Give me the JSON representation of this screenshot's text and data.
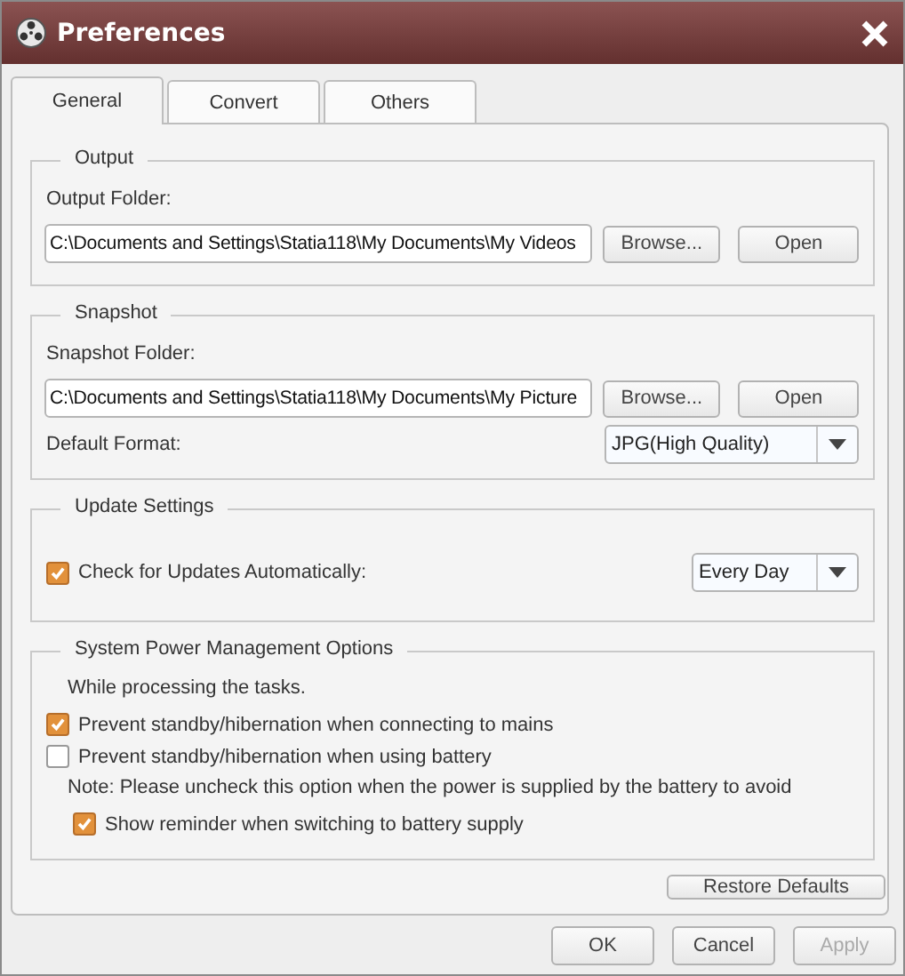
{
  "window": {
    "title": "Preferences"
  },
  "tabs": [
    {
      "label": "General",
      "selected": true
    },
    {
      "label": "Convert",
      "selected": false
    },
    {
      "label": "Others",
      "selected": false
    }
  ],
  "groups": [
    {
      "title": "Output",
      "rows": [
        {
          "kind": "label",
          "text": "Output Folder:"
        },
        {
          "kind": "path",
          "value": "C:\\Documents and Settings\\Statia118\\My Documents\\My Videos",
          "buttons": [
            "Browse...",
            "Open"
          ]
        }
      ]
    },
    {
      "title": "Snapshot",
      "rows": [
        {
          "kind": "label",
          "text": "Snapshot Folder:"
        },
        {
          "kind": "path",
          "value": "C:\\Documents and Settings\\Statia118\\My Documents\\My Picture",
          "buttons": [
            "Browse...",
            "Open"
          ]
        },
        {
          "kind": "combo",
          "text": "Default Format:",
          "value": "JPG(High Quality)"
        }
      ]
    },
    {
      "title": "Update Settings",
      "rows": [
        {
          "kind": "check-combo",
          "text": "Check for Updates Automatically:",
          "checked": true,
          "value": "Every Day"
        }
      ]
    },
    {
      "title": "System Power Management Options",
      "rows": [
        {
          "kind": "note",
          "text": "While processing the tasks."
        },
        {
          "kind": "check",
          "text": "Prevent standby/hibernation when connecting to mains",
          "checked": true
        },
        {
          "kind": "check",
          "text": "Prevent standby/hibernation when using battery",
          "checked": false
        },
        {
          "kind": "note",
          "text": "Note: Please uncheck this option when the power is supplied by the battery to avoid"
        },
        {
          "kind": "subcheck",
          "text": "Show reminder when switching to battery supply",
          "checked": true
        }
      ]
    }
  ],
  "restore": "Restore Defaults",
  "buttons": [
    {
      "label": "OK",
      "disabled": false
    },
    {
      "label": "Cancel",
      "disabled": false
    },
    {
      "label": "Apply",
      "disabled": true
    }
  ]
}
